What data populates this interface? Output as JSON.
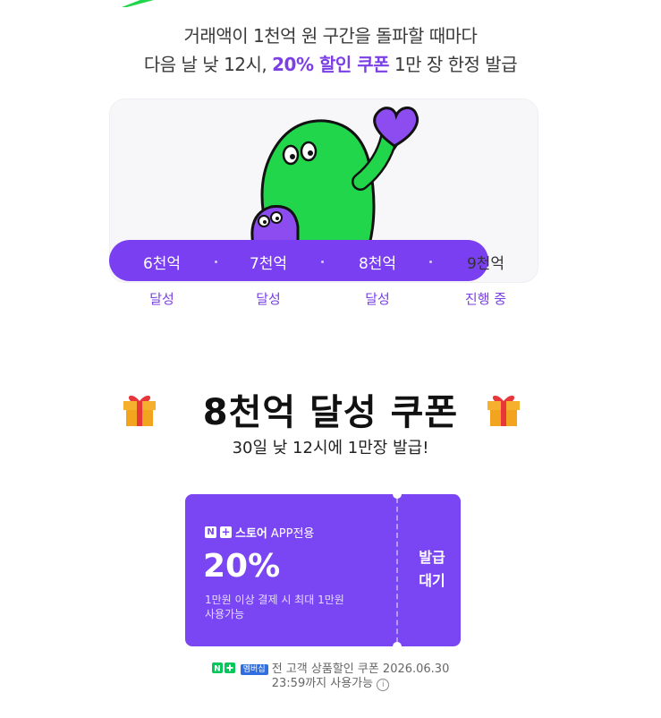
{
  "intro": {
    "line1": "거래액이 1천억 원 구간을 돌파할 때마다",
    "line2_prefix": "다음 날 낮 12시, ",
    "line2_highlight": "20% 할인 쿠폰",
    "line2_suffix": " 1만 장 한정 발급"
  },
  "progress": {
    "steps": [
      {
        "label": "6천억",
        "status": "달성"
      },
      {
        "label": "7천억",
        "status": "달성"
      },
      {
        "label": "8천억",
        "status": "달성"
      },
      {
        "label": "9천억",
        "status": "진행 중"
      }
    ]
  },
  "coupon_section": {
    "title": "8천억 달성 쿠폰",
    "subtitle": "30일 낮 12시에 1만장 발급!"
  },
  "coupon": {
    "brand_n": "N",
    "brand_plus": "+",
    "brand_label": "스토어",
    "brand_app": "APP전용",
    "discount": "20%",
    "condition_line1": "1만원 이상 결제 시 최대 1만원",
    "condition_line2": "사용가능",
    "issue_line1": "발급",
    "issue_line2": "대기"
  },
  "note": {
    "badge_np": "N+",
    "badge_member": "멤버십",
    "line1": "전 고객 상품할인 쿠폰 2026.06.30",
    "line2": "23:59까지 사용가능",
    "info_icon": "i"
  },
  "colors": {
    "accent": "#7b3fe4",
    "track": "#7a3ff0",
    "coupon_bg": "#7a45f2",
    "mascot_green": "#22d64b",
    "mascot_purple": "#8c4cf0"
  }
}
